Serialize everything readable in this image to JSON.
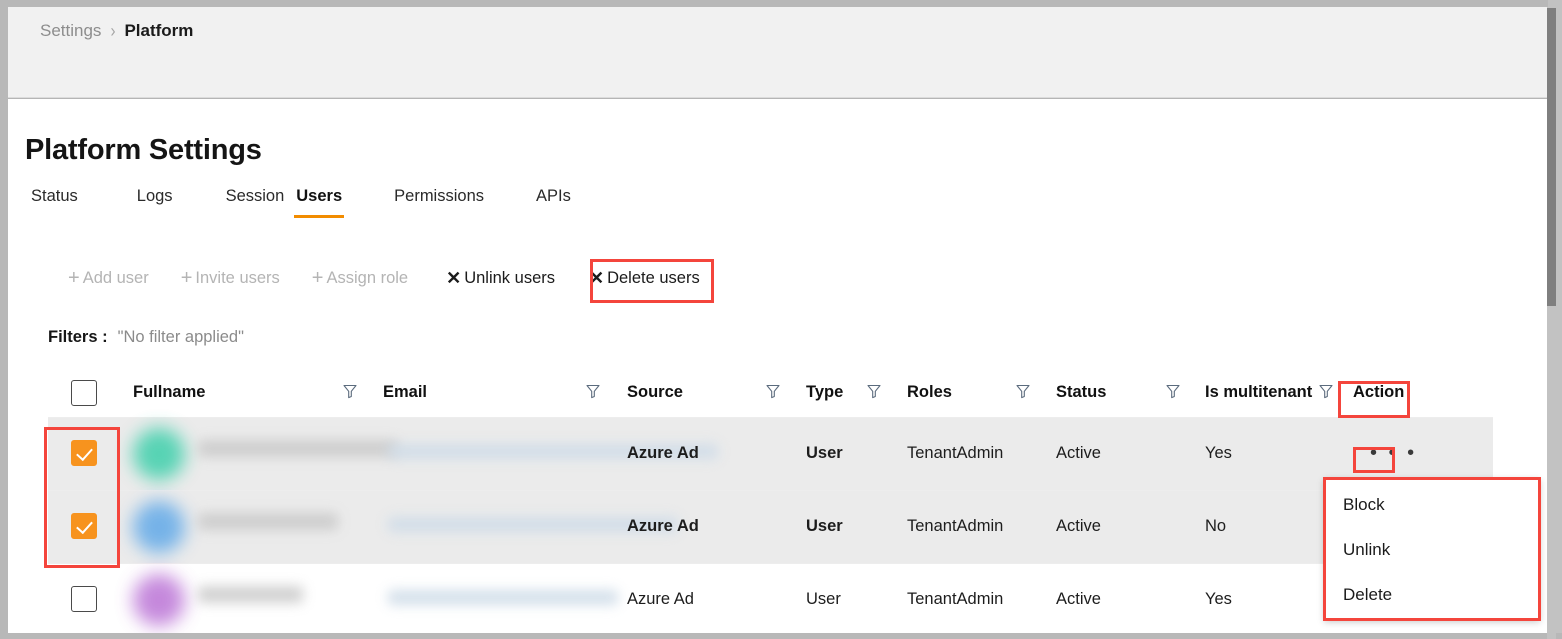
{
  "breadcrumb": {
    "parent": "Settings",
    "separator": "›",
    "current": "Platform"
  },
  "page": {
    "title": "Platform Settings"
  },
  "tabs": [
    {
      "label": "Status",
      "active": false
    },
    {
      "label": "Logs",
      "active": false
    },
    {
      "label": "Session",
      "active": false
    },
    {
      "label": "Users",
      "active": true
    },
    {
      "label": "Permissions",
      "active": false
    },
    {
      "label": "APIs",
      "active": false
    }
  ],
  "toolbar": {
    "add_user": {
      "label": "Add user",
      "icon": "plus-icon",
      "disabled": true
    },
    "invite_users": {
      "label": "Invite users",
      "icon": "plus-icon",
      "disabled": true
    },
    "assign_role": {
      "label": "Assign role",
      "icon": "plus-icon",
      "disabled": true
    },
    "unlink_users": {
      "label": "Unlink users",
      "icon": "close-icon",
      "disabled": false
    },
    "delete_users": {
      "label": "Delete users",
      "icon": "close-icon",
      "disabled": false,
      "highlighted": true
    }
  },
  "filters": {
    "label": "Filters :",
    "value": "\"No filter applied\""
  },
  "table": {
    "columns": [
      "Fullname",
      "Email",
      "Source",
      "Type",
      "Roles",
      "Status",
      "Is multitenant",
      "Action"
    ],
    "select_all_checked": false,
    "rows": [
      {
        "selected": true,
        "avatar_color": "#3ecfab",
        "fullname": "",
        "email": "",
        "source": "Azure Ad",
        "type": "User",
        "roles": "TenantAdmin",
        "status": "Active",
        "is_multitenant": "Yes",
        "action": "• • •"
      },
      {
        "selected": true,
        "avatar_color": "#61a9e8",
        "fullname": "",
        "email": "",
        "source": "Azure Ad",
        "type": "User",
        "roles": "TenantAdmin",
        "status": "Active",
        "is_multitenant": "No",
        "action": ""
      },
      {
        "selected": false,
        "avatar_color": "#bb74d6",
        "fullname": "",
        "email": "",
        "source": "Azure Ad",
        "type": "User",
        "roles": "TenantAdmin",
        "status": "Active",
        "is_multitenant": "Yes",
        "action": ""
      }
    ]
  },
  "action_menu": {
    "visible": true,
    "items": [
      "Block",
      "Unlink",
      "Delete"
    ]
  },
  "colors": {
    "accent_orange": "#f28c00",
    "checkbox_orange": "#f7931e",
    "highlight_red": "#f4453c",
    "header_bg": "#f1f1f1",
    "selected_row_bg": "#ebebeb"
  }
}
